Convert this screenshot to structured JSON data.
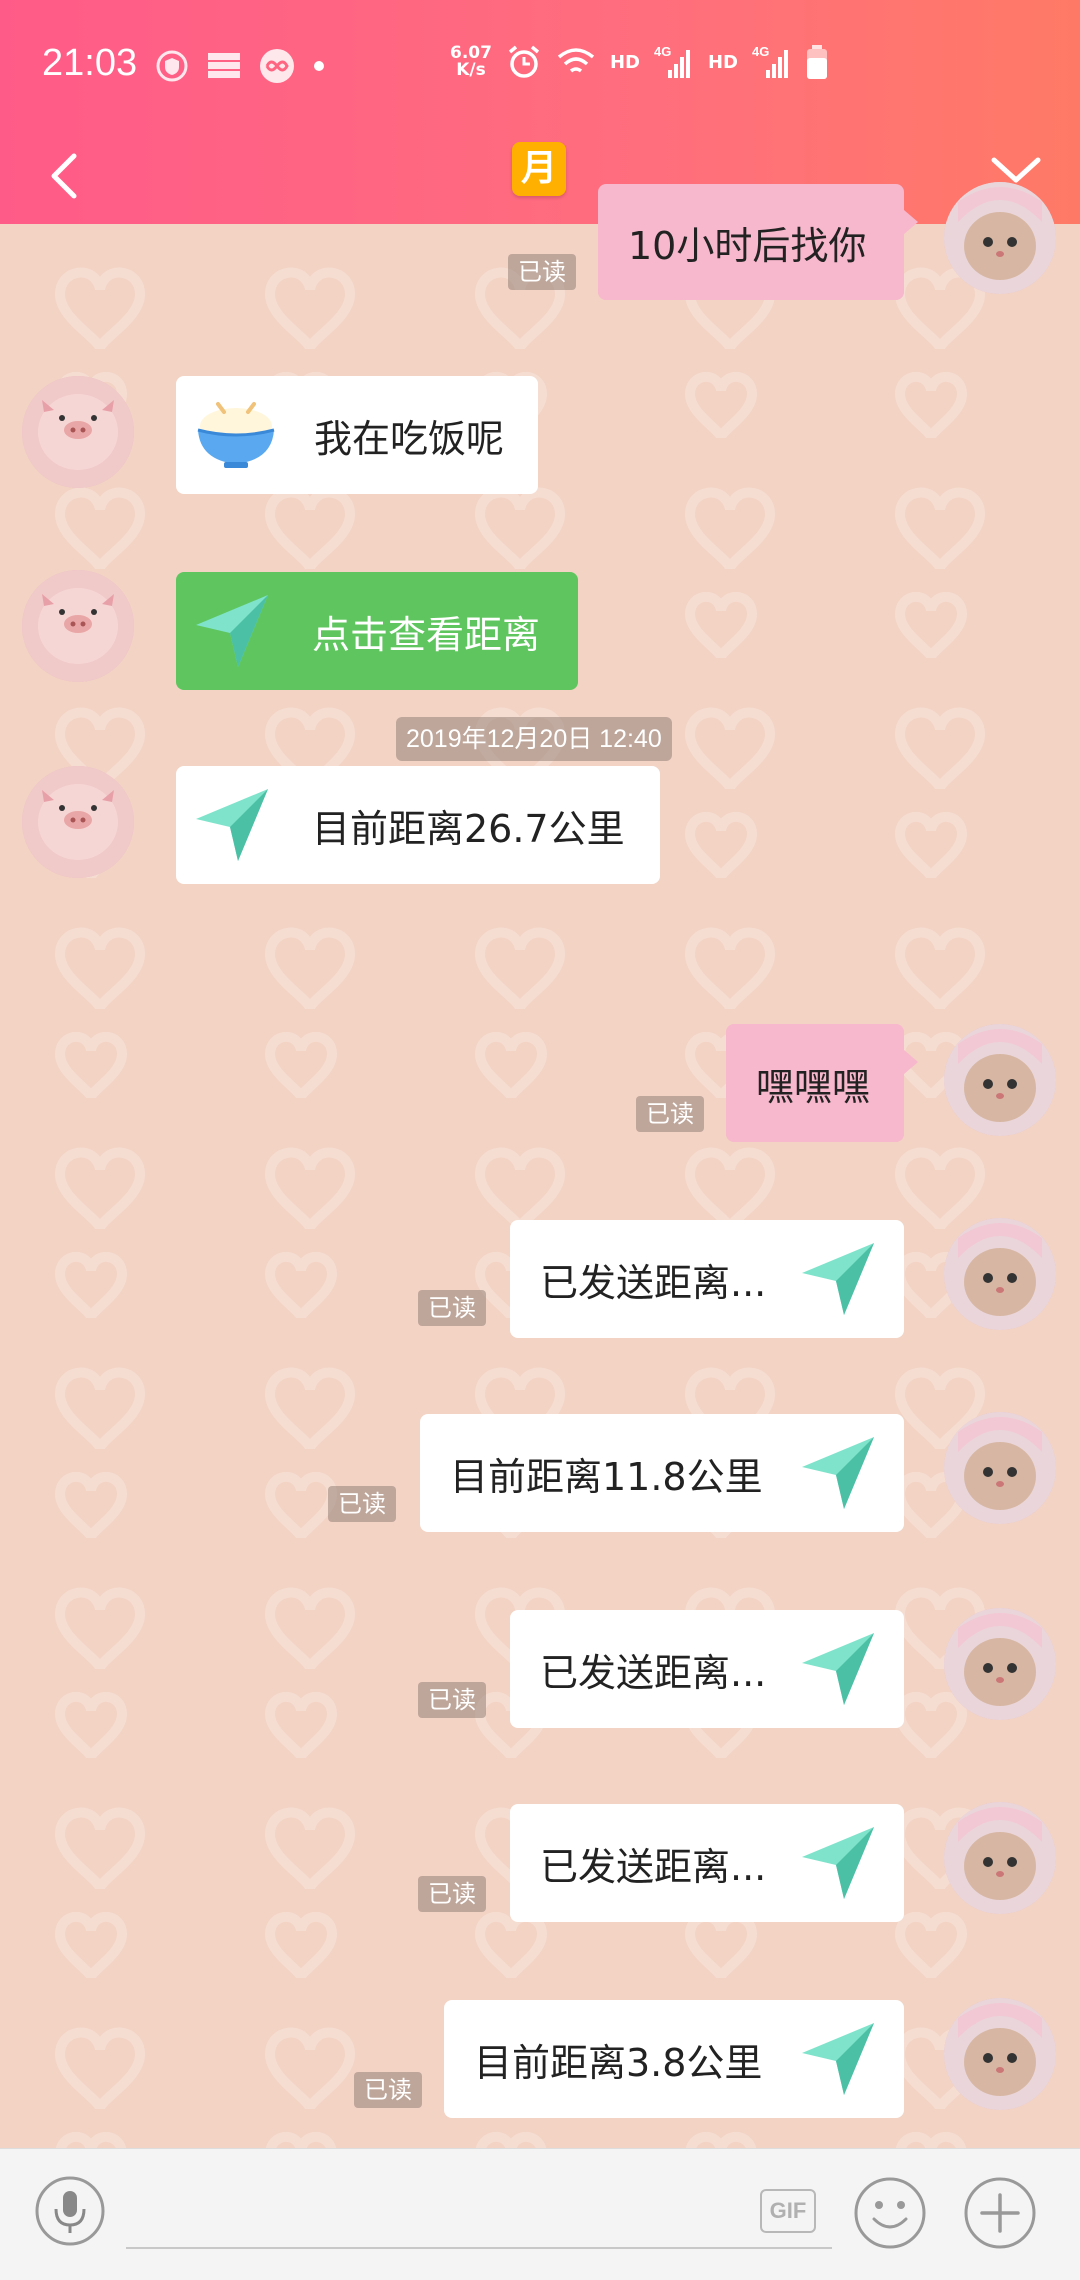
{
  "status_bar": {
    "time": "21:03",
    "speed_value": "6.07",
    "speed_unit": "K/s",
    "hd1": "HD",
    "hd2": "HD",
    "net1": "4G",
    "net2": "4G",
    "icons": [
      "shield-icon",
      "server-icon",
      "infinity-icon",
      "dot-icon",
      "alarm-icon",
      "wifi-icon",
      "signal-icon",
      "signal-icon",
      "battery-icon"
    ]
  },
  "nav": {
    "title": "月"
  },
  "colors": {
    "header_start": "#ff5b88",
    "header_end": "#ff7a66",
    "chat_bg": "#f2d3c4",
    "sent_bubble": "#f7b7cc",
    "location_green": "#5fc65f",
    "arrow_teal": "#6fdcc0"
  },
  "messages": [
    {
      "side": "right",
      "type": "text",
      "text": "10小时后找你",
      "read": "已读"
    },
    {
      "side": "left",
      "type": "sticker-text",
      "icon": "rice-bowl-icon",
      "text": "我在吃饭呢"
    },
    {
      "side": "left",
      "type": "location-request",
      "icon": "send-arrow-icon",
      "text": "点击查看距离"
    },
    {
      "side": "left",
      "type": "location",
      "icon": "send-arrow-icon",
      "text": "目前距离26.7公里"
    },
    {
      "side": "right",
      "type": "text",
      "text": "嘿嘿嘿",
      "read": "已读"
    },
    {
      "side": "right",
      "type": "location",
      "icon": "send-arrow-icon",
      "text": "已发送距离...",
      "read": "已读"
    },
    {
      "side": "right",
      "type": "location",
      "icon": "send-arrow-icon",
      "text": "目前距离11.8公里",
      "read": "已读"
    },
    {
      "side": "right",
      "type": "location",
      "icon": "send-arrow-icon",
      "text": "已发送距离...",
      "read": "已读"
    },
    {
      "side": "right",
      "type": "location",
      "icon": "send-arrow-icon",
      "text": "已发送距离...",
      "read": "已读"
    },
    {
      "side": "right",
      "type": "location",
      "icon": "send-arrow-icon",
      "text": "目前距离3.8公里",
      "read": "已读"
    }
  ],
  "timestamp": "2019年12月20日 12:40",
  "input": {
    "placeholder": "",
    "gif_label": "GIF"
  }
}
